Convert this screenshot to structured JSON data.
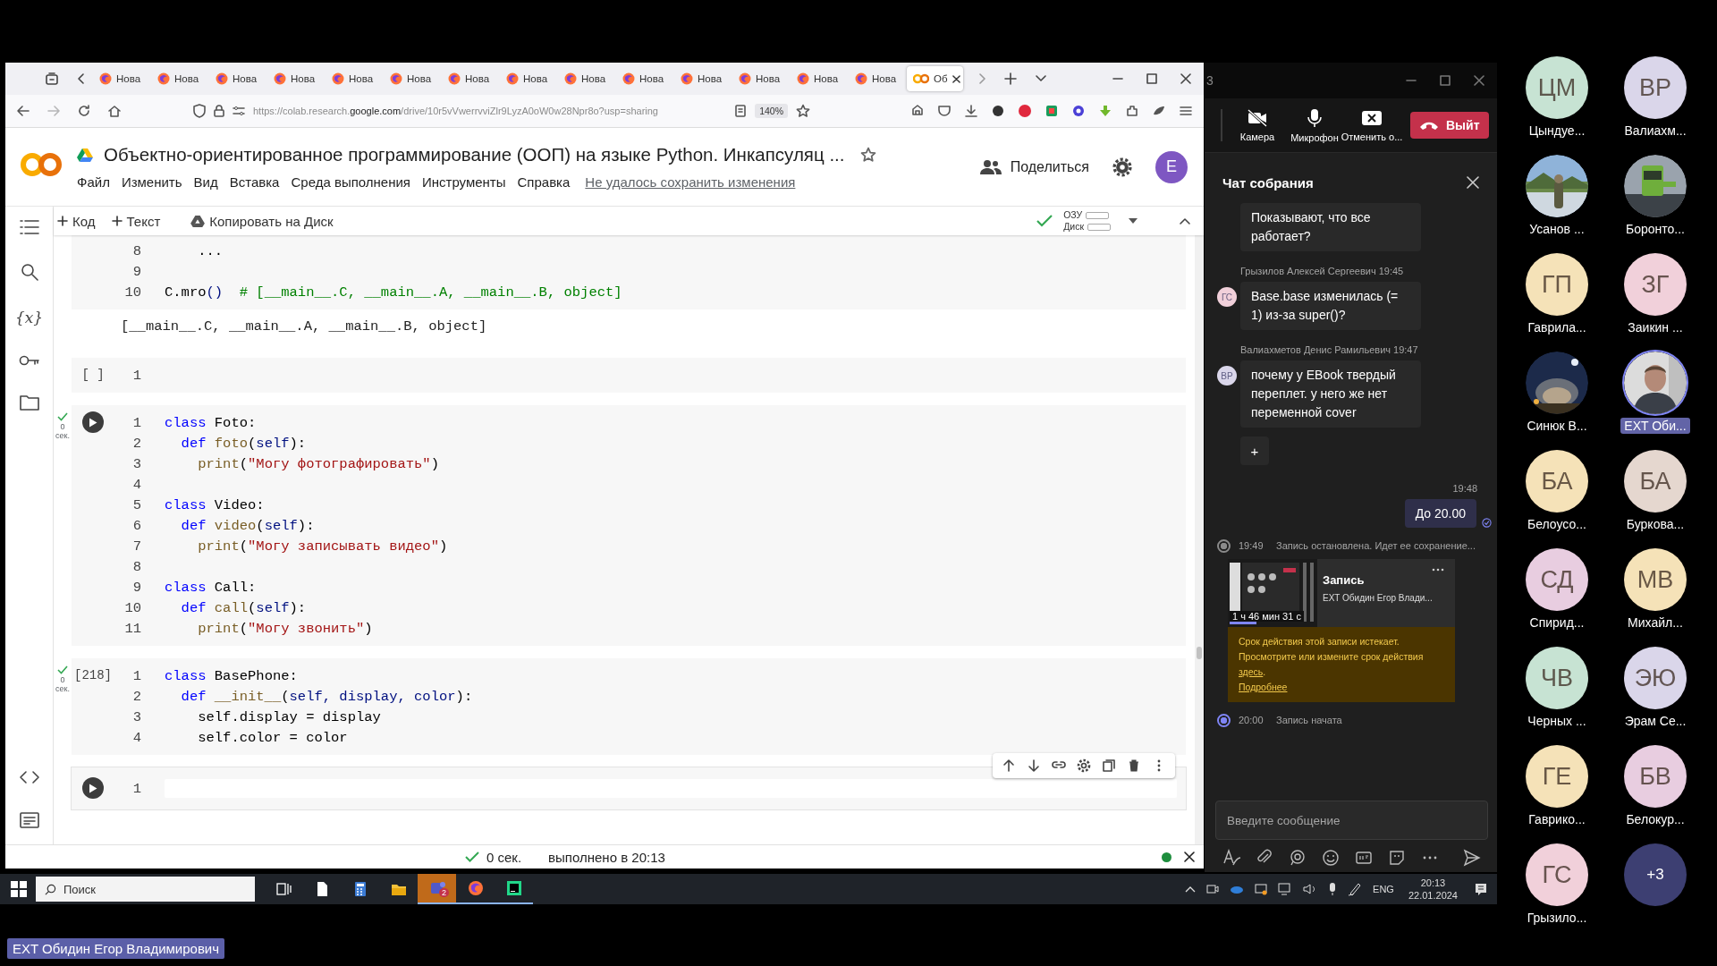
{
  "browser": {
    "tabs": [
      {
        "label": "Нова",
        "kind": "firefox",
        "selected": false
      },
      {
        "label": "Нова",
        "kind": "firefox",
        "selected": false
      },
      {
        "label": "Нова",
        "kind": "firefox",
        "selected": false
      },
      {
        "label": "Нова",
        "kind": "firefox",
        "selected": false
      },
      {
        "label": "Нова",
        "kind": "firefox",
        "selected": false
      },
      {
        "label": "Нова",
        "kind": "firefox",
        "selected": false
      },
      {
        "label": "Нова",
        "kind": "firefox",
        "selected": false
      },
      {
        "label": "Нова",
        "kind": "firefox",
        "selected": false
      },
      {
        "label": "Нова",
        "kind": "firefox",
        "selected": false
      },
      {
        "label": "Нова",
        "kind": "firefox",
        "selected": false
      },
      {
        "label": "Нова",
        "kind": "firefox",
        "selected": false
      },
      {
        "label": "Нова",
        "kind": "firefox",
        "selected": false
      },
      {
        "label": "Нова",
        "kind": "firefox",
        "selected": false
      },
      {
        "label": "Нова",
        "kind": "firefox",
        "selected": false
      },
      {
        "label": "Об",
        "kind": "colab",
        "selected": true
      }
    ],
    "url": "https://colab.research.**google.com**/drive/10r5vVwerrvviZlr9LyzA0oW0w28Npr8o?usp=sharing",
    "zoom": "140%"
  },
  "notebook": {
    "title": "Объектно-ориентированное программирование (ООП) на языке Python. Инкапсуляц ...",
    "menu": [
      "Файл",
      "Изменить",
      "Вид",
      "Вставка",
      "Среда выполнения",
      "Инструменты",
      "Справка"
    ],
    "save_status": "Не удалось сохранить изменения",
    "share": "Поделиться",
    "avatar": "E",
    "toolbar": {
      "add": [
        "Код",
        "Текст"
      ],
      "copy": "Копировать на Диск",
      "ram": "ОЗУ",
      "disk": "Диск",
      "connected": true
    },
    "sidebar": [
      {
        "kind": "toc"
      },
      {
        "kind": "search"
      },
      {
        "kind": "variables",
        "label": "{x}"
      },
      {
        "kind": "secrets"
      },
      {
        "kind": "files"
      }
    ],
    "sidebar_bottom": [
      {
        "kind": "code"
      },
      {
        "kind": "terminal"
      }
    ],
    "cells": [
      {
        "kind": "no_gutter",
        "focused": false,
        "lines": [
          {
            "n": "8",
            "code": [
              {
                "kind": "plain",
                "text": "    ..."
              }
            ]
          },
          {
            "n": "9"
          },
          {
            "n": "10",
            "code": [
              {
                "kind": "plain",
                "text": "C.mro"
              },
              {
                "kind": "var",
                "text": "()"
              },
              {
                "kind": "comment",
                "text": "  # [__main__.C, __main__.A, __main__.B, object]"
              }
            ]
          }
        ],
        "output": "[__main__.C, __main__.A, __main__.B, object]"
      },
      {
        "kind": "prompt",
        "prompt": "[ ]",
        "focused": false,
        "lines": [
          {
            "n": "1"
          }
        ]
      },
      {
        "kind": "run",
        "focused": false,
        "status": {
          "done": true,
          "time": "0 сек."
        },
        "lines": [
          {
            "n": "1",
            "code": [
              {
                "kind": "keyword",
                "text": "class"
              },
              {
                "kind": "plain",
                "text": " Foto:"
              }
            ]
          },
          {
            "n": "2",
            "code": [
              {
                "kind": "keyword",
                "text": "  def "
              },
              {
                "kind": "function",
                "text": "foto"
              },
              {
                "kind": "plain",
                "text": "("
              },
              {
                "kind": "var",
                "text": "self"
              },
              {
                "kind": "plain",
                "text": "):"
              }
            ]
          },
          {
            "n": "3",
            "code": [
              {
                "kind": "function",
                "text": "    print"
              },
              {
                "kind": "plain",
                "text": "("
              },
              {
                "kind": "string",
                "text": "\"Могу фотографировать\""
              },
              {
                "kind": "plain",
                "text": ")"
              }
            ]
          },
          {
            "n": "4"
          },
          {
            "n": "5",
            "code": [
              {
                "kind": "keyword",
                "text": "class"
              },
              {
                "kind": "plain",
                "text": " Video:"
              }
            ]
          },
          {
            "n": "6",
            "code": [
              {
                "kind": "keyword",
                "text": "  def "
              },
              {
                "kind": "function",
                "text": "video"
              },
              {
                "kind": "plain",
                "text": "("
              },
              {
                "kind": "var",
                "text": "self"
              },
              {
                "kind": "plain",
                "text": "):"
              }
            ]
          },
          {
            "n": "7",
            "code": [
              {
                "kind": "function",
                "text": "    print"
              },
              {
                "kind": "plain",
                "text": "("
              },
              {
                "kind": "string",
                "text": "\"Могу записывать видео\""
              },
              {
                "kind": "plain",
                "text": ")"
              }
            ]
          },
          {
            "n": "8"
          },
          {
            "n": "9",
            "code": [
              {
                "kind": "keyword",
                "text": "class"
              },
              {
                "kind": "plain",
                "text": " Call:"
              }
            ]
          },
          {
            "n": "10",
            "code": [
              {
                "kind": "keyword",
                "text": "  def "
              },
              {
                "kind": "function",
                "text": "call"
              },
              {
                "kind": "plain",
                "text": "("
              },
              {
                "kind": "var",
                "text": "self"
              },
              {
                "kind": "plain",
                "text": "):"
              }
            ]
          },
          {
            "n": "11",
            "code": [
              {
                "kind": "function",
                "text": "    print"
              },
              {
                "kind": "plain",
                "text": "("
              },
              {
                "kind": "string",
                "text": "\"Могу звонить\""
              },
              {
                "kind": "plain",
                "text": ")"
              }
            ]
          }
        ]
      },
      {
        "kind": "prompt",
        "prompt": "[218]",
        "focused": false,
        "status": {
          "done": true,
          "time": "0 сек."
        },
        "lines": [
          {
            "n": "1",
            "code": [
              {
                "kind": "keyword",
                "text": "class"
              },
              {
                "kind": "plain",
                "text": " BasePhone:"
              }
            ]
          },
          {
            "n": "2",
            "code": [
              {
                "kind": "keyword",
                "text": "  def "
              },
              {
                "kind": "function",
                "text": "__init__"
              },
              {
                "kind": "plain",
                "text": "("
              },
              {
                "kind": "var",
                "text": "self, display, color"
              },
              {
                "kind": "plain",
                "text": "):"
              }
            ]
          },
          {
            "n": "3",
            "code": [
              {
                "kind": "plain",
                "text": "    self.display = display"
              }
            ]
          },
          {
            "n": "4",
            "code": [
              {
                "kind": "plain",
                "text": "    self.color = color"
              }
            ]
          }
        ]
      },
      {
        "kind": "run",
        "focused": true,
        "lines": [
          {
            "n": "1"
          }
        ]
      }
    ],
    "status_bar": {
      "time": "0 сек.",
      "message": "выполнено в 20:13",
      "connected": true
    }
  },
  "teams": {
    "window_title": "3",
    "controls": [
      {
        "kind": "camera",
        "label": "Камера"
      },
      {
        "kind": "mic",
        "label": "Микрофон"
      },
      {
        "kind": "share",
        "label": "Отменить о..."
      }
    ],
    "leave": "Выйт",
    "chat": {
      "title": "Чат собрания",
      "messages": [
        {
          "kind": "incoming",
          "text": "Показывают, что все работает?"
        },
        {
          "kind": "incoming",
          "author": "Грызилов Алексей Сергеевич",
          "time": "19:45",
          "avatar": {
            "initials": "ГС",
            "color": "#f1d0da"
          },
          "text": "Base.base изменилась (= 1) из-за super()?"
        },
        {
          "kind": "incoming",
          "author": "Валиахметов Денис Рамильевич",
          "time": "19:47",
          "avatar": {
            "initials": "ВР",
            "color": "#dad6ea"
          },
          "text": "почему у EBook твердый переплет. у него же нет переменной  cover"
        },
        {
          "kind": "reaction_add",
          "label": "+"
        },
        {
          "kind": "outgoing",
          "time": "19:48",
          "text": "До 20.00"
        },
        {
          "kind": "event",
          "time": "19:49",
          "text": "Запись остановлена. Идет ее сохранение...",
          "color": "#8a8a8a"
        },
        {
          "kind": "recording",
          "title": "Запись",
          "owner": "EXT Обидин Егор Влади...",
          "duration": "1 ч 46 мин 31 с",
          "warning": "Срок действия этой записи истекает. Просмотрите или измените срок действия ",
          "link": "здесь",
          "after_link": ".",
          "more": "Подробнее"
        },
        {
          "kind": "event",
          "time": "20:00",
          "text": "Запись начата",
          "color": "#7f85f5"
        }
      ],
      "placeholder": "Введите сообщение"
    }
  },
  "participants": [
    {
      "kind": "initials",
      "initials": "ЦМ",
      "name": "Цындуе...",
      "color": "#c7e3d3",
      "active": false
    },
    {
      "kind": "initials",
      "initials": "ВР",
      "name": "Валиахм...",
      "color": "#dad6ea",
      "active": false
    },
    {
      "kind": "picture",
      "name": "Усанов ...",
      "active": false
    },
    {
      "kind": "picture",
      "name": "Боронто...",
      "active": false
    },
    {
      "kind": "initials",
      "initials": "ГП",
      "name": "Гаврила...",
      "color": "#f5e2b8",
      "active": false
    },
    {
      "kind": "initials",
      "initials": "ЗГ",
      "name": "Заикин ...",
      "color": "#f1d0da",
      "active": false
    },
    {
      "kind": "picture",
      "name": "Синюк В...",
      "active": false
    },
    {
      "kind": "picture",
      "name": "EXT Оби...",
      "active": true
    },
    {
      "kind": "initials",
      "initials": "БА",
      "name": "Белоусо...",
      "color": "#f5e2b8",
      "active": false
    },
    {
      "kind": "initials",
      "initials": "БА",
      "name": "Буркова...",
      "color": "#e5d7cf",
      "active": false
    },
    {
      "kind": "initials",
      "initials": "СД",
      "name": "Спирид...",
      "color": "#e8cde0",
      "active": false
    },
    {
      "kind": "initials",
      "initials": "МВ",
      "name": "Михайл...",
      "color": "#f5e2b8",
      "active": false
    },
    {
      "kind": "initials",
      "initials": "ЧВ",
      "name": "Черных ...",
      "color": "#c7e3d3",
      "active": false
    },
    {
      "kind": "initials",
      "initials": "ЭЮ",
      "name": "Эрам Се...",
      "color": "#dad6ea",
      "active": false
    },
    {
      "kind": "initials",
      "initials": "ГЕ",
      "name": "Гаврико...",
      "color": "#f5e2b8",
      "active": false
    },
    {
      "kind": "initials",
      "initials": "БВ",
      "name": "Белокур...",
      "color": "#e8cde0",
      "active": false
    },
    {
      "kind": "initials",
      "initials": "ГС",
      "name": "Грызило...",
      "color": "#f1d0da",
      "active": false
    },
    {
      "kind": "more",
      "initials": "+3",
      "color": "#3d3f72"
    }
  ],
  "taskbar": {
    "search": "Поиск",
    "apps": [
      {
        "kind": "taskview",
        "running": false,
        "flashing": false
      },
      {
        "kind": "file",
        "running": false,
        "flashing": false
      },
      {
        "kind": "calculator",
        "running": false,
        "flashing": false
      },
      {
        "kind": "folder",
        "running": false,
        "flashing": false
      },
      {
        "kind": "teams",
        "badge": "2",
        "running": true,
        "flashing": true
      },
      {
        "kind": "firefox",
        "running": true,
        "flashing": false
      },
      {
        "kind": "pycharm",
        "running": true,
        "flashing": false
      }
    ],
    "language": "ENG",
    "time": "20:13",
    "date": "22.01.2024"
  },
  "speaker": "EXT Обидин Егор Владимирович"
}
